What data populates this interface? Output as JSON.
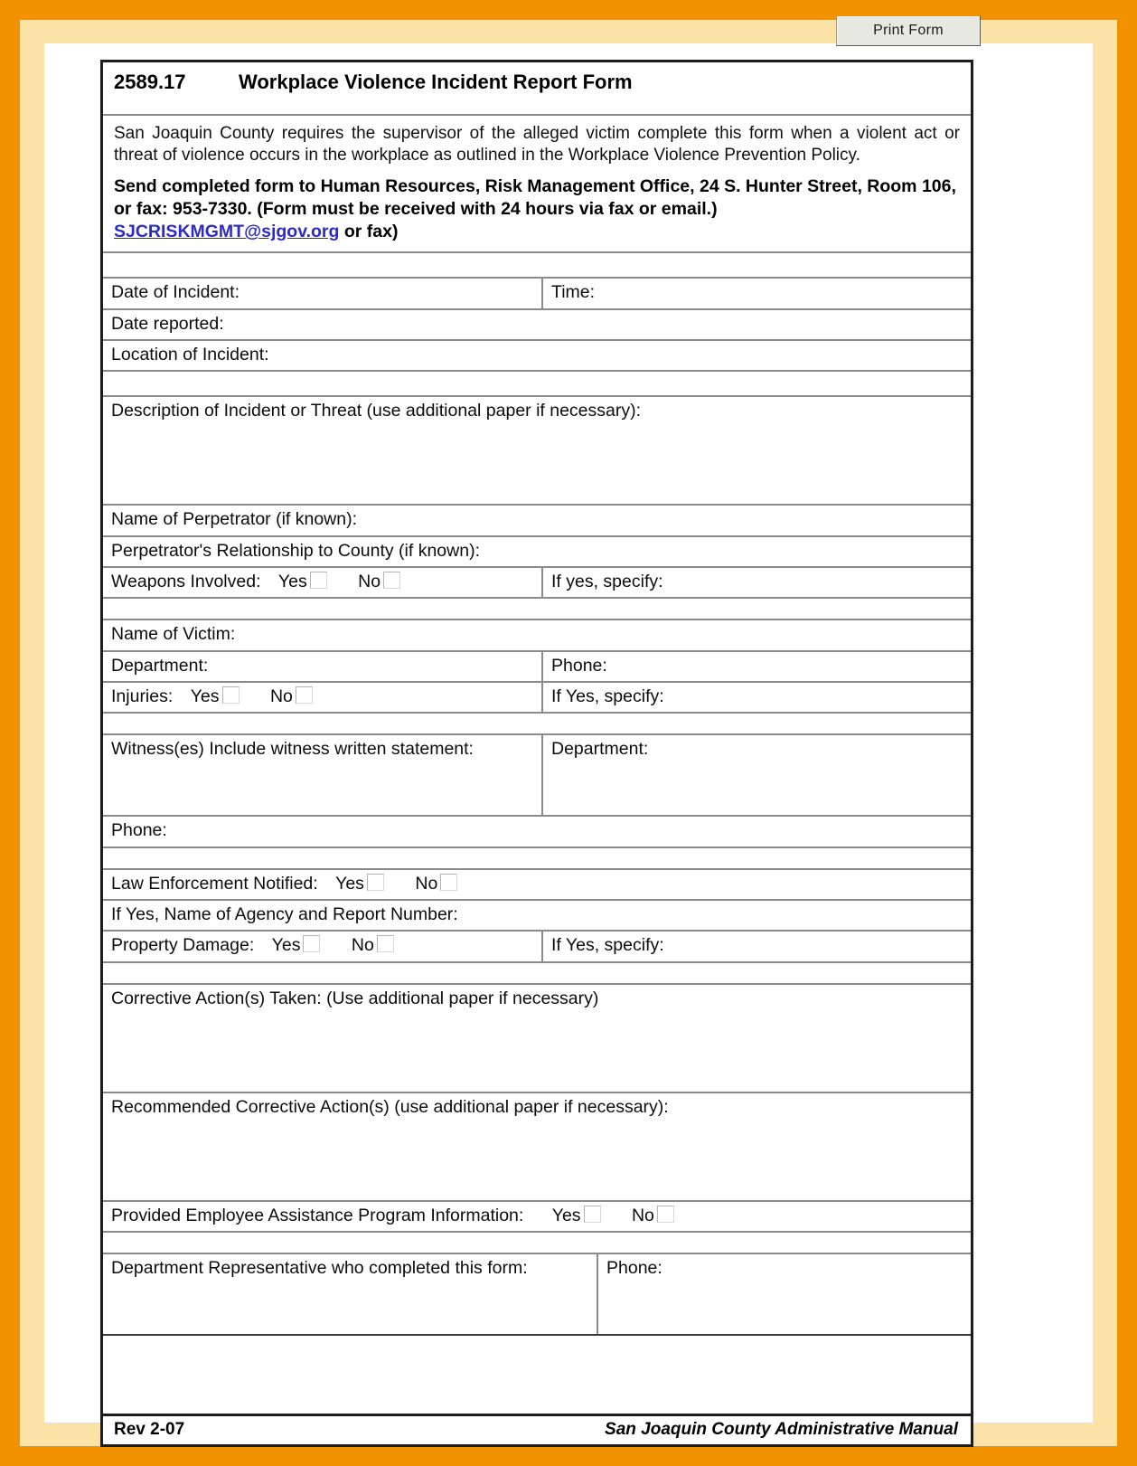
{
  "toolbar": {
    "print_form_label": "Print Form"
  },
  "form": {
    "number": "2589.17",
    "title": "Workplace Violence Incident Report Form",
    "intro_paragraph": "San Joaquin County requires the supervisor of the alleged victim complete this form when a violent act or threat of violence occurs in the workplace as outlined in the Workplace Violence Prevention Policy.",
    "send_instructions": "Send completed form to Human Resources, Risk Management Office, 24 S. Hunter Street, Room 106, or fax:  953-7330.  (Form must be received with 24 hours via fax or email.)",
    "email_link": "SJCRISKMGMT@sjgov.org",
    "email_suffix": " or fax)",
    "fields": {
      "date_of_incident": "Date of Incident:",
      "time": "Time:",
      "date_reported": "Date reported:",
      "location_of_incident": "Location of Incident:",
      "description": "Description of Incident or Threat (use additional paper if necessary):",
      "name_of_perpetrator": "Name of Perpetrator (if known):",
      "perpetrator_relationship": "Perpetrator's Relationship to County (if known):",
      "weapons_involved": "Weapons Involved:",
      "if_yes_specify_lower": "If yes, specify:",
      "name_of_victim": "Name of Victim:",
      "department": "Department:",
      "phone": "Phone:",
      "injuries": "Injuries:",
      "if_yes_specify_upper": "If Yes, specify:",
      "witnesses": "Witness(es) Include witness written statement:",
      "witness_department": "Department:",
      "witness_phone": "Phone:",
      "law_enforcement_notified": "Law Enforcement Notified:",
      "agency_and_report_number": "If Yes, Name of Agency and Report Number:",
      "property_damage": "Property Damage:",
      "property_if_yes_specify": "If Yes, specify:",
      "corrective_actions_taken": "Corrective Action(s) Taken: (Use additional paper if necessary)",
      "recommended_corrective_actions": "Recommended Corrective Action(s) (use additional paper if necessary):",
      "eap_information": "Provided Employee Assistance Program Information:",
      "dept_representative": "Department Representative who completed this form:",
      "dept_representative_phone": "Phone:"
    },
    "choices": {
      "yes": "Yes",
      "no": "No"
    },
    "footer": {
      "revision": "Rev 2-07",
      "manual": "San Joaquin County Administrative Manual"
    }
  },
  "colors": {
    "scan_border": "#f39200",
    "scan_border_inner": "#fbe3a8",
    "link": "#2c2cc4",
    "rule": "#8a8a8a",
    "outer_rule": "#1c1c1c",
    "button_face": "#e8e8e2"
  }
}
